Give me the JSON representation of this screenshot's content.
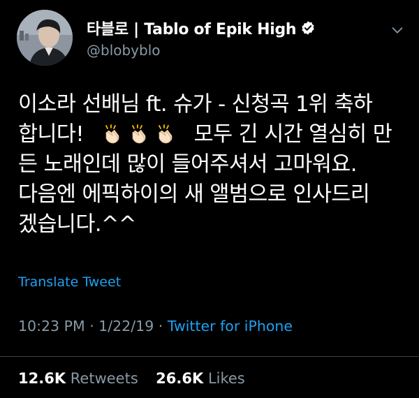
{
  "author": {
    "display_name": "타블로 | Tablo of Epik High",
    "handle": "@blobyblo"
  },
  "tweet": {
    "line1": "이소라 선배님 ft. 슈가 - 신청곡 1위 축하",
    "line2_start": "합니다!",
    "line2_end": "모두 긴 시간 열심히 만",
    "line3": "든 노래인데 많이 들어주셔서 고마워요.",
    "line4": "다음엔 에픽하이의 새 앨범으로 인사드리",
    "line5": "겠습니다.^^",
    "emoji": [
      "clapping-hands",
      "clapping-hands",
      "clapping-hands"
    ]
  },
  "translate_label": "Translate Tweet",
  "meta": {
    "time": "10:23 PM",
    "date": "1/22/19",
    "source": "Twitter for iPhone"
  },
  "stats": {
    "retweets_count": "12.6K",
    "retweets_label": "Retweets",
    "likes_count": "26.6K",
    "likes_label": "Likes"
  },
  "colors": {
    "background": "#000000",
    "accent": "#1da1f2",
    "secondary_text": "#8899a6",
    "divider": "#38444d"
  }
}
